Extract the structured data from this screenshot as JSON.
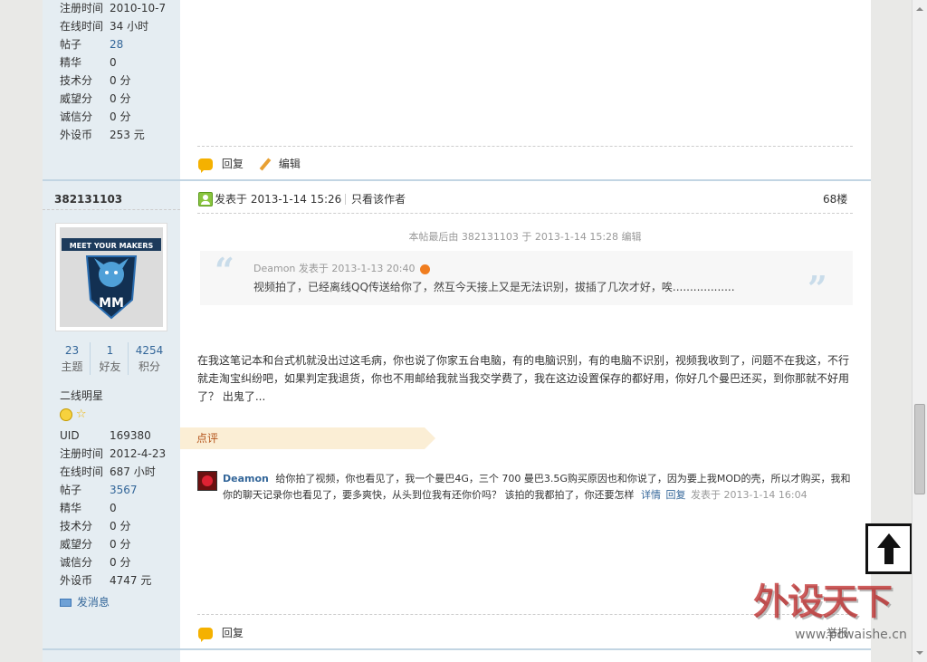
{
  "post1": {
    "profile": [
      {
        "k": "注册时间",
        "v": "2010-10-7"
      },
      {
        "k": "在线时间",
        "v": "34 小时"
      },
      {
        "k": "帖子",
        "v": "28"
      },
      {
        "k": "精华",
        "v": "0"
      },
      {
        "k": "技术分",
        "v": "0 分"
      },
      {
        "k": "威望分",
        "v": "0 分"
      },
      {
        "k": "诚信分",
        "v": "0 分"
      },
      {
        "k": "外设币",
        "v": "253 元"
      }
    ],
    "reply_label": "回复",
    "edit_label": "编辑"
  },
  "post2": {
    "username": "382131103",
    "avatar_text": "MEET YOUR MAKERS",
    "stats": [
      {
        "value": "23",
        "label": "主题"
      },
      {
        "value": "1",
        "label": "好友"
      },
      {
        "value": "4254",
        "label": "积分"
      }
    ],
    "rank": "二线明星",
    "profile": [
      {
        "k": "UID",
        "v": "169380"
      },
      {
        "k": "注册时间",
        "v": "2012-4-23"
      },
      {
        "k": "在线时间",
        "v": "687 小时"
      },
      {
        "k": "帖子",
        "v": "3567"
      },
      {
        "k": "精华",
        "v": "0"
      },
      {
        "k": "技术分",
        "v": "0 分"
      },
      {
        "k": "威望分",
        "v": "0 分"
      },
      {
        "k": "诚信分",
        "v": "0 分"
      },
      {
        "k": "外设币",
        "v": "4747 元"
      }
    ],
    "send_msg": "发消息",
    "posted_at": "发表于 2013-1-14 15:26",
    "only_author": "只看该作者",
    "floor": "68楼",
    "edit_note": "本帖最后由 382131103 于 2013-1-14 15:28 编辑",
    "quote_author": "Deamon 发表于 2013-1-13 20:40",
    "quote_text": "视频拍了，已经离线QQ传送给你了，然互今天接上又是无法识别，拔插了几次才好，唉..................",
    "body": "在我这笔记本和台式机就没出过这毛病，你也说了你家五台电脑，有的电脑识别，有的电脑不识别，视频我收到了，问题不在我这，不行就走淘宝纠纷吧，如果判定我退货，你也不用邮给我就当我交学费了，我在这边设置保存的都好用，你好几个曼巴还买，到你那就不好用了？ 出鬼了...",
    "comment_header": "点评",
    "comment_user": "Deamon",
    "comment_text": "给你拍了视频，你也看见了，我一个曼巴4G，三个 700 曼巴3.5G购买原因也和你说了，因为要上我MOD的壳，所以才购买，我和你的聊天记录你也看见了，要多爽快，从头到位我有还你价吗？ 该拍的我都拍了，你还要怎样",
    "comment_detail": "详情",
    "comment_reply": "回复",
    "comment_time": "发表于 2013-1-14 16:04",
    "reply_label": "回复",
    "more_label": "举报"
  },
  "watermark": {
    "brand": "外设天下",
    "url": "www.pcwaishe.cn"
  },
  "colors": {
    "accent": "#336699",
    "sidebar": "#e5edf2",
    "comment_bar": "#fbeed5"
  }
}
